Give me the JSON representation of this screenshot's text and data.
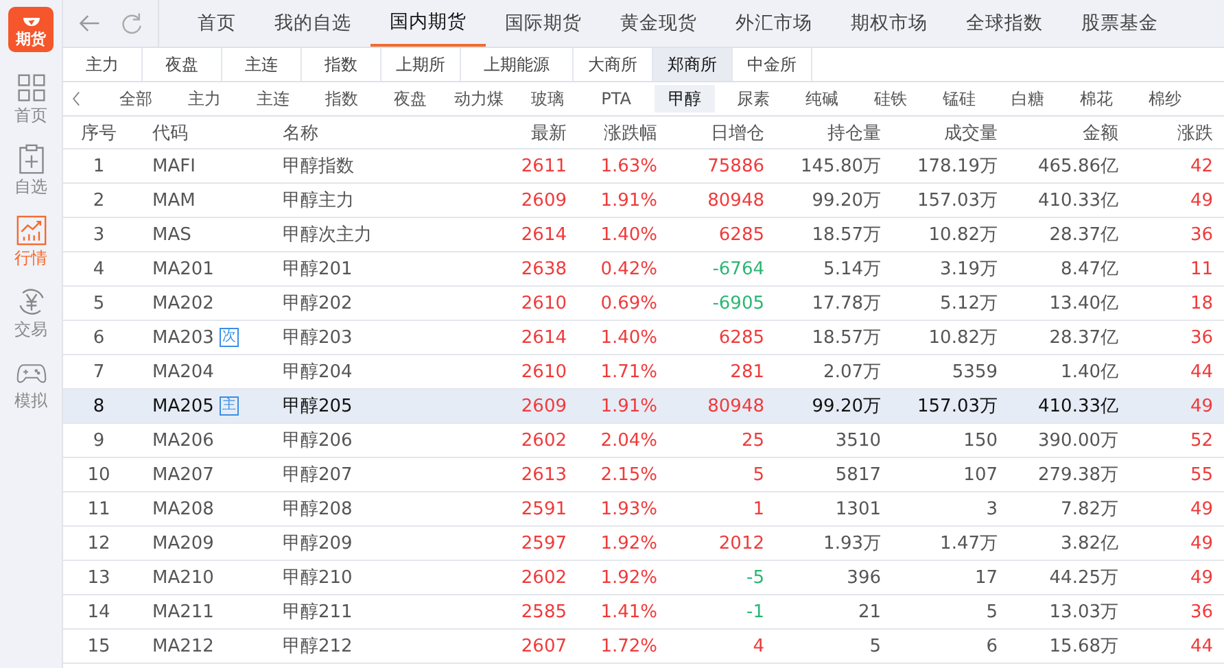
{
  "sidebar": {
    "logo": "期货",
    "items": [
      {
        "label": "首页",
        "kind": "grid",
        "selected": false
      },
      {
        "label": "自选",
        "kind": "clipboard",
        "selected": false
      },
      {
        "label": "行情",
        "kind": "chart",
        "selected": true
      },
      {
        "label": "交易",
        "kind": "yen",
        "selected": false
      },
      {
        "label": "模拟",
        "kind": "gamepad",
        "selected": false
      }
    ]
  },
  "nav": {
    "tabs": [
      {
        "label": "首页",
        "selected": false
      },
      {
        "label": "我的自选",
        "selected": false
      },
      {
        "label": "国内期货",
        "selected": true
      },
      {
        "label": "国际期货",
        "selected": false
      },
      {
        "label": "黄金现货",
        "selected": false
      },
      {
        "label": "外汇市场",
        "selected": false
      },
      {
        "label": "期权市场",
        "selected": false
      },
      {
        "label": "全球指数",
        "selected": false
      },
      {
        "label": "股票基金",
        "selected": false
      }
    ]
  },
  "exchange_tabs": [
    {
      "label": "主力",
      "selected": false
    },
    {
      "label": "夜盘",
      "selected": false
    },
    {
      "label": "主连",
      "selected": false
    },
    {
      "label": "指数",
      "selected": false
    },
    {
      "label": "上期所",
      "selected": false
    },
    {
      "label": "上期能源",
      "selected": false
    },
    {
      "label": "大商所",
      "selected": false
    },
    {
      "label": "郑商所",
      "selected": true
    },
    {
      "label": "中金所",
      "selected": false
    }
  ],
  "product_tabs": [
    {
      "label": "全部",
      "selected": false
    },
    {
      "label": "主力",
      "selected": false
    },
    {
      "label": "主连",
      "selected": false
    },
    {
      "label": "指数",
      "selected": false
    },
    {
      "label": "夜盘",
      "selected": false
    },
    {
      "label": "动力煤",
      "selected": false
    },
    {
      "label": "玻璃",
      "selected": false
    },
    {
      "label": "PTA",
      "selected": false
    },
    {
      "label": "甲醇",
      "selected": true
    },
    {
      "label": "尿素",
      "selected": false
    },
    {
      "label": "纯碱",
      "selected": false
    },
    {
      "label": "硅铁",
      "selected": false
    },
    {
      "label": "锰硅",
      "selected": false
    },
    {
      "label": "白糖",
      "selected": false
    },
    {
      "label": "棉花",
      "selected": false
    },
    {
      "label": "棉纱",
      "selected": false
    }
  ],
  "table": {
    "columns": [
      "序号",
      "代码",
      "名称",
      "最新",
      "涨跌幅",
      "日增仓",
      "持仓量",
      "成交量",
      "金额",
      "涨跌"
    ],
    "rows": [
      {
        "no": "1",
        "code": "MAFI",
        "name": "甲醇指数",
        "last": "2611",
        "pct": "1.63%",
        "oi_change": {
          "text": "75886",
          "color": "#f03a3a"
        },
        "oi": "145.80万",
        "volume": "178.19万",
        "amount": "465.86亿",
        "change": "42",
        "color": "#f03a3a",
        "selected": false
      },
      {
        "no": "2",
        "code": "MAM",
        "name": "甲醇主力",
        "last": "2609",
        "pct": "1.91%",
        "oi_change": {
          "text": "80948",
          "color": "#f03a3a"
        },
        "oi": "99.20万",
        "volume": "157.03万",
        "amount": "410.33亿",
        "change": "49",
        "color": "#f03a3a",
        "selected": false
      },
      {
        "no": "3",
        "code": "MAS",
        "name": "甲醇次主力",
        "last": "2614",
        "pct": "1.40%",
        "oi_change": {
          "text": "6285",
          "color": "#f03a3a"
        },
        "oi": "18.57万",
        "volume": "10.82万",
        "amount": "28.37亿",
        "change": "36",
        "color": "#f03a3a",
        "selected": false
      },
      {
        "no": "4",
        "code": "MA201",
        "name": "甲醇201",
        "last": "2638",
        "pct": "0.42%",
        "oi_change": {
          "text": "-6764",
          "color": "#2bb673"
        },
        "oi": "5.14万",
        "volume": "3.19万",
        "amount": "8.47亿",
        "change": "11",
        "color": "#f03a3a",
        "selected": false
      },
      {
        "no": "5",
        "code": "MA202",
        "name": "甲醇202",
        "last": "2610",
        "pct": "0.69%",
        "oi_change": {
          "text": "-6905",
          "color": "#2bb673"
        },
        "oi": "17.78万",
        "volume": "5.12万",
        "amount": "13.40亿",
        "change": "18",
        "color": "#f03a3a",
        "selected": false
      },
      {
        "no": "6",
        "code": "MA203",
        "badge": "次",
        "name": "甲醇203",
        "last": "2614",
        "pct": "1.40%",
        "oi_change": {
          "text": "6285",
          "color": "#f03a3a"
        },
        "oi": "18.57万",
        "volume": "10.82万",
        "amount": "28.37亿",
        "change": "36",
        "color": "#f03a3a",
        "selected": false
      },
      {
        "no": "7",
        "code": "MA204",
        "name": "甲醇204",
        "last": "2610",
        "pct": "1.71%",
        "oi_change": {
          "text": "281",
          "color": "#f03a3a"
        },
        "oi": "2.07万",
        "volume": "5359",
        "amount": "1.40亿",
        "change": "44",
        "color": "#f03a3a",
        "selected": false
      },
      {
        "no": "8",
        "code": "MA205",
        "badge": "主",
        "name": "甲醇205",
        "last": "2609",
        "pct": "1.91%",
        "oi_change": {
          "text": "80948",
          "color": "#f03a3a"
        },
        "oi": "99.20万",
        "volume": "157.03万",
        "amount": "410.33亿",
        "change": "49",
        "color": "#f03a3a",
        "selected": true
      },
      {
        "no": "9",
        "code": "MA206",
        "name": "甲醇206",
        "last": "2602",
        "pct": "2.04%",
        "oi_change": {
          "text": "25",
          "color": "#f03a3a"
        },
        "oi": "3510",
        "volume": "150",
        "amount": "390.00万",
        "change": "52",
        "color": "#f03a3a",
        "selected": false
      },
      {
        "no": "10",
        "code": "MA207",
        "name": "甲醇207",
        "last": "2613",
        "pct": "2.15%",
        "oi_change": {
          "text": "5",
          "color": "#f03a3a"
        },
        "oi": "5817",
        "volume": "107",
        "amount": "279.38万",
        "change": "55",
        "color": "#f03a3a",
        "selected": false
      },
      {
        "no": "11",
        "code": "MA208",
        "name": "甲醇208",
        "last": "2591",
        "pct": "1.93%",
        "oi_change": {
          "text": "1",
          "color": "#f03a3a"
        },
        "oi": "1301",
        "volume": "3",
        "amount": "7.82万",
        "change": "49",
        "color": "#f03a3a",
        "selected": false
      },
      {
        "no": "12",
        "code": "MA209",
        "name": "甲醇209",
        "last": "2597",
        "pct": "1.92%",
        "oi_change": {
          "text": "2012",
          "color": "#f03a3a"
        },
        "oi": "1.93万",
        "volume": "1.47万",
        "amount": "3.82亿",
        "change": "49",
        "color": "#f03a3a",
        "selected": false
      },
      {
        "no": "13",
        "code": "MA210",
        "name": "甲醇210",
        "last": "2602",
        "pct": "1.92%",
        "oi_change": {
          "text": "-5",
          "color": "#2bb673"
        },
        "oi": "396",
        "volume": "17",
        "amount": "44.25万",
        "change": "49",
        "color": "#f03a3a",
        "selected": false
      },
      {
        "no": "14",
        "code": "MA211",
        "name": "甲醇211",
        "last": "2585",
        "pct": "1.41%",
        "oi_change": {
          "text": "-1",
          "color": "#2bb673"
        },
        "oi": "21",
        "volume": "5",
        "amount": "13.03万",
        "change": "36",
        "color": "#f03a3a",
        "selected": false
      },
      {
        "no": "15",
        "code": "MA212",
        "name": "甲醇212",
        "last": "2607",
        "pct": "1.72%",
        "oi_change": {
          "text": "4",
          "color": "#f03a3a"
        },
        "oi": "5",
        "volume": "6",
        "amount": "15.68万",
        "change": "44",
        "color": "#f03a3a",
        "selected": false
      }
    ]
  }
}
